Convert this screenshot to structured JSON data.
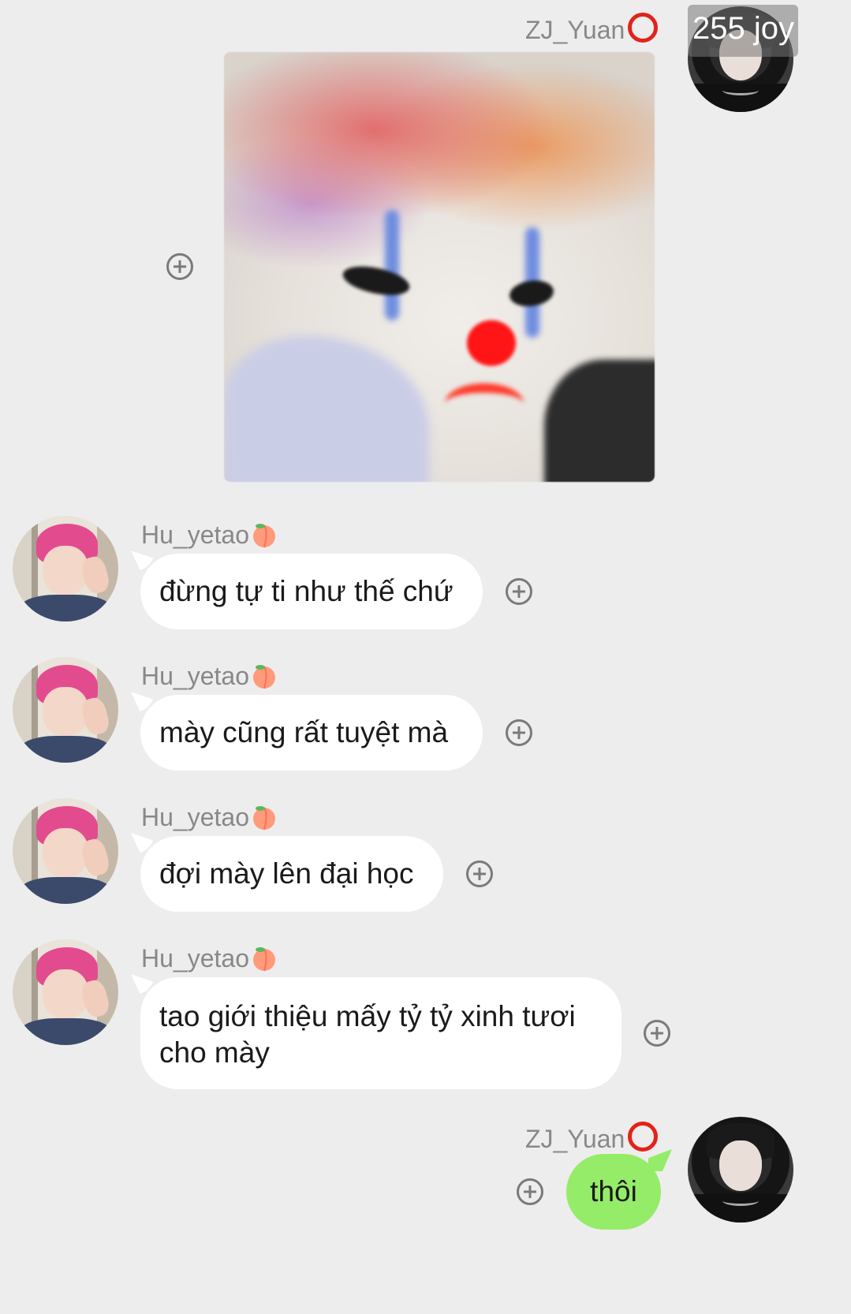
{
  "sender_self": {
    "name": "ZJ_Yuan",
    "badge_text": "255 joy",
    "status_icon": "red-circle-icon"
  },
  "sender_other": {
    "name": "Hu_yetao",
    "status_icon": "peach-icon"
  },
  "messages": [
    {
      "from": "self",
      "type": "image",
      "description_icon": "clown-cat-sticker"
    },
    {
      "from": "other",
      "text": "đừng tự ti như thế chứ"
    },
    {
      "from": "other",
      "text": "mày cũng rất tuyệt mà"
    },
    {
      "from": "other",
      "text": "đợi mày lên đại học"
    },
    {
      "from": "other",
      "text": "tao giới thiệu mấy tỷ tỷ xinh tươi cho mày"
    },
    {
      "from": "self",
      "text": "thôi"
    }
  ],
  "colors": {
    "background": "#ededed",
    "bubble_other": "#ffffff",
    "bubble_self": "#95ec69",
    "nickname": "#888888"
  }
}
